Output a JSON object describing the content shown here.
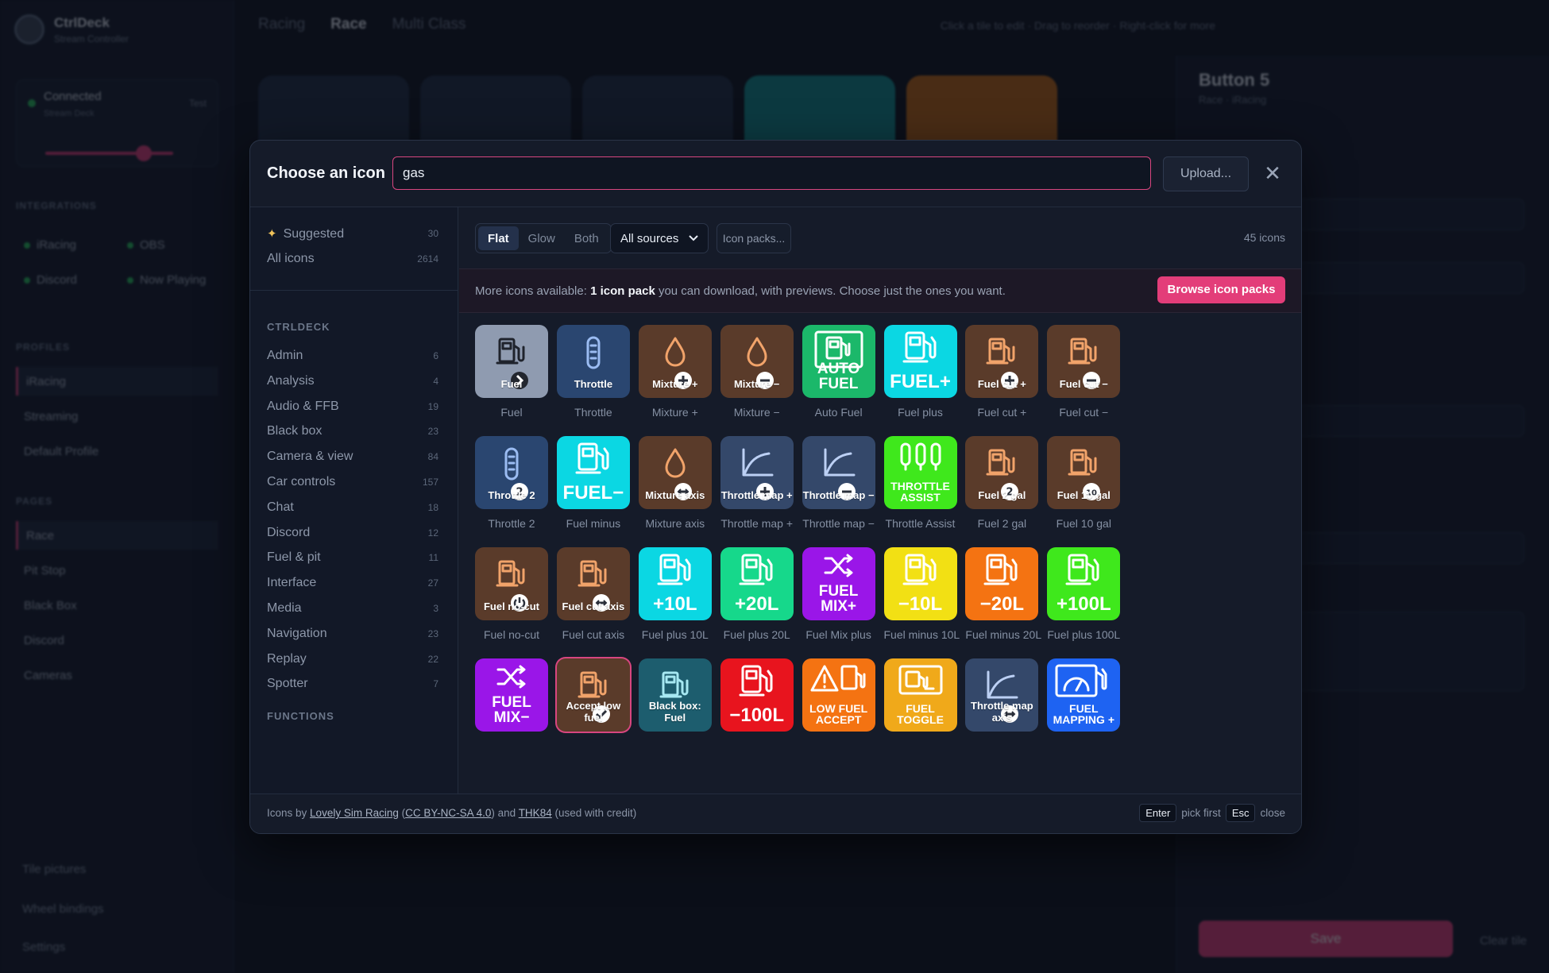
{
  "app": {
    "brand_name": "CtrlDeck",
    "brand_sub": "Stream Controller",
    "connection_title": "Connected",
    "connection_sub": "Stream Deck",
    "connection_test": "Test",
    "tabs": [
      "Racing",
      "Race",
      "Multi Class"
    ],
    "active_tab": "Race",
    "hints": "Click a tile to edit · Drag to reorder · Right-click for more",
    "sidebar": {
      "integrations_heading": "INTEGRATIONS",
      "integrations": [
        "iRacing",
        "OBS",
        "Discord",
        "Now Playing"
      ],
      "profiles_heading": "PROFILES",
      "profiles": [
        "iRacing",
        "Streaming",
        "Default Profile"
      ],
      "pages_heading": "PAGES",
      "pages": [
        "Race",
        "Pit Stop",
        "Black Box",
        "Discord",
        "Cameras"
      ],
      "footer": [
        "Tile pictures",
        "Wheel bindings",
        "Settings"
      ]
    },
    "editor": {
      "title": "Button 5",
      "sub": "Race · iRacing",
      "save": "Save",
      "clear": "Clear tile"
    }
  },
  "modal": {
    "title": "Choose an icon",
    "search_value": "gas",
    "upload_label": "Upload...",
    "close_glyph": "✕",
    "categories_top": [
      {
        "label": "Suggested",
        "count": "30"
      },
      {
        "label": "All icons",
        "count": "2614"
      }
    ],
    "section_ctrldeck": "CTRLDECK",
    "categories": [
      {
        "label": "Admin",
        "count": "6"
      },
      {
        "label": "Analysis",
        "count": "4"
      },
      {
        "label": "Audio & FFB",
        "count": "19"
      },
      {
        "label": "Black box",
        "count": "23"
      },
      {
        "label": "Camera & view",
        "count": "84"
      },
      {
        "label": "Car controls",
        "count": "157"
      },
      {
        "label": "Chat",
        "count": "18"
      },
      {
        "label": "Discord",
        "count": "12"
      },
      {
        "label": "Fuel & pit",
        "count": "11"
      },
      {
        "label": "Interface",
        "count": "27"
      },
      {
        "label": "Media",
        "count": "3"
      },
      {
        "label": "Navigation",
        "count": "23"
      },
      {
        "label": "Replay",
        "count": "22"
      },
      {
        "label": "Spotter",
        "count": "7"
      }
    ],
    "section_functions": "FUNCTIONS",
    "styles": [
      "Flat",
      "Glow",
      "Both"
    ],
    "active_style": "Flat",
    "source_selected": "All sources",
    "packs_label": "Icon packs...",
    "icon_count": "45 icons",
    "banner": {
      "prefix": "More icons available:",
      "bold": "1 icon pack",
      "suffix": "you can download, with previews. Choose just the ones you want.",
      "button": "Browse icon packs"
    },
    "icons": [
      {
        "label": "Fuel",
        "caption": "Fuel",
        "bg": "#8f9bb0",
        "glyph": "pump",
        "badge": "arrow"
      },
      {
        "label": "Throttle",
        "caption": "Throttle",
        "bg": "#2a4670",
        "glyph": "bar"
      },
      {
        "label": "Mixture +",
        "caption": "Mixture +",
        "bg": "#5a3b2a",
        "glyph": "drop",
        "badge": "plus"
      },
      {
        "label": "Mixture −",
        "caption": "Mixture −",
        "bg": "#5a3b2a",
        "glyph": "drop",
        "badge": "minus"
      },
      {
        "label": "AUTO FUEL",
        "caption": "Auto Fuel",
        "bg": "#1bb86a",
        "glyph": "autofuel",
        "big": true
      },
      {
        "label": "FUEL+",
        "caption": "Fuel plus",
        "bg": "#0bd7e3",
        "glyph": "pumpbig",
        "big": true
      },
      {
        "label": "Fuel cut +",
        "caption": "Fuel cut +",
        "bg": "#5a3b2a",
        "glyph": "pump",
        "badge": "plus"
      },
      {
        "label": "Fuel cut −",
        "caption": "Fuel cut −",
        "bg": "#5a3b2a",
        "glyph": "pump",
        "badge": "minus"
      },
      {
        "label": "Throttle 2",
        "caption": "Throttle 2",
        "bg": "#2a4670",
        "glyph": "bar",
        "badge": "2"
      },
      {
        "label": "FUEL−",
        "caption": "Fuel minus",
        "bg": "#0bd7e3",
        "glyph": "pumpbig",
        "big": true
      },
      {
        "label": "Mixture axis",
        "caption": "Mixture axis",
        "bg": "#5a3b2a",
        "glyph": "drop",
        "badge": "axis"
      },
      {
        "label": "Throttle map +",
        "caption": "Throttle map +",
        "bg": "#34486a",
        "glyph": "map",
        "badge": "plus"
      },
      {
        "label": "Throttle map −",
        "caption": "Throttle map −",
        "bg": "#34486a",
        "glyph": "map",
        "badge": "minus"
      },
      {
        "label": "THROTTLE ASSIST",
        "caption": "Throttle Assist",
        "bg": "#3fe81c",
        "glyph": "assist",
        "big": true
      },
      {
        "label": "Fuel 2 gal",
        "caption": "Fuel 2 gal",
        "bg": "#5a3b2a",
        "glyph": "pump",
        "badge": "2"
      },
      {
        "label": "Fuel 10 gal",
        "caption": "Fuel 10 gal",
        "bg": "#5a3b2a",
        "glyph": "pump",
        "badge": "10"
      },
      {
        "label": "Fuel no-cut",
        "caption": "Fuel no-cut",
        "bg": "#5a3b2a",
        "glyph": "pump",
        "badge": "power"
      },
      {
        "label": "Fuel cut axis",
        "caption": "Fuel cut axis",
        "bg": "#5a3b2a",
        "glyph": "pump",
        "badge": "axis"
      },
      {
        "label": "+10L",
        "caption": "Fuel plus 10L",
        "bg": "#0bd7e3",
        "glyph": "pumpbig",
        "big": true
      },
      {
        "label": "+20L",
        "caption": "Fuel plus 20L",
        "bg": "#16d88b",
        "glyph": "pumpbig",
        "big": true
      },
      {
        "label": "FUEL MIX+",
        "caption": "Fuel Mix plus",
        "bg": "#9a16e8",
        "glyph": "mix",
        "big": true
      },
      {
        "label": "−10L",
        "caption": "Fuel minus 10L",
        "bg": "#f2e014",
        "glyph": "pumpbig",
        "big": true
      },
      {
        "label": "−20L",
        "caption": "Fuel minus 20L",
        "bg": "#f47312",
        "glyph": "pumpbig",
        "big": true
      },
      {
        "label": "+100L",
        "caption": "Fuel plus 100L",
        "bg": "#3fe81c",
        "glyph": "pumpbig",
        "big": true
      },
      {
        "label": "FUEL MIX−",
        "caption": "",
        "bg": "#9a16e8",
        "glyph": "mix",
        "big": true
      },
      {
        "label": "Accept low fuel",
        "caption": "",
        "bg": "#5a3b2a",
        "glyph": "pump",
        "badge": "check",
        "selected": true
      },
      {
        "label": "Black box: Fuel",
        "caption": "",
        "bg": "#1d5d6e",
        "glyph": "pump"
      },
      {
        "label": "−100L",
        "caption": "",
        "bg": "#e8141e",
        "glyph": "pumpbig",
        "big": true
      },
      {
        "label": "LOW FUEL ACCEPT",
        "caption": "",
        "bg": "#f47312",
        "glyph": "lowfuel",
        "big": true
      },
      {
        "label": "FUEL TOGGLE",
        "caption": "",
        "bg": "#f0a91a",
        "glyph": "toggle",
        "big": true
      },
      {
        "label": "Throttle map axis",
        "caption": "",
        "bg": "#34486a",
        "glyph": "map",
        "badge": "axis"
      },
      {
        "label": "FUEL MAPPING +",
        "caption": "",
        "bg": "#1e63f2",
        "glyph": "gauge",
        "big": true
      }
    ],
    "footer": {
      "credit_prefix": "Icons by",
      "credit_author": "Lovely Sim Racing",
      "credit_license": "CC BY-NC-SA 4.0",
      "credit_and": "and",
      "credit_second": "THK84",
      "credit_suffix": "(used with credit)",
      "key_enter": "Enter",
      "key_enter_label": "pick first",
      "key_esc": "Esc",
      "key_esc_label": "close"
    }
  },
  "colors": {
    "accent": "#e33d79",
    "panel": "#151b29",
    "page": "#0b0f19"
  }
}
